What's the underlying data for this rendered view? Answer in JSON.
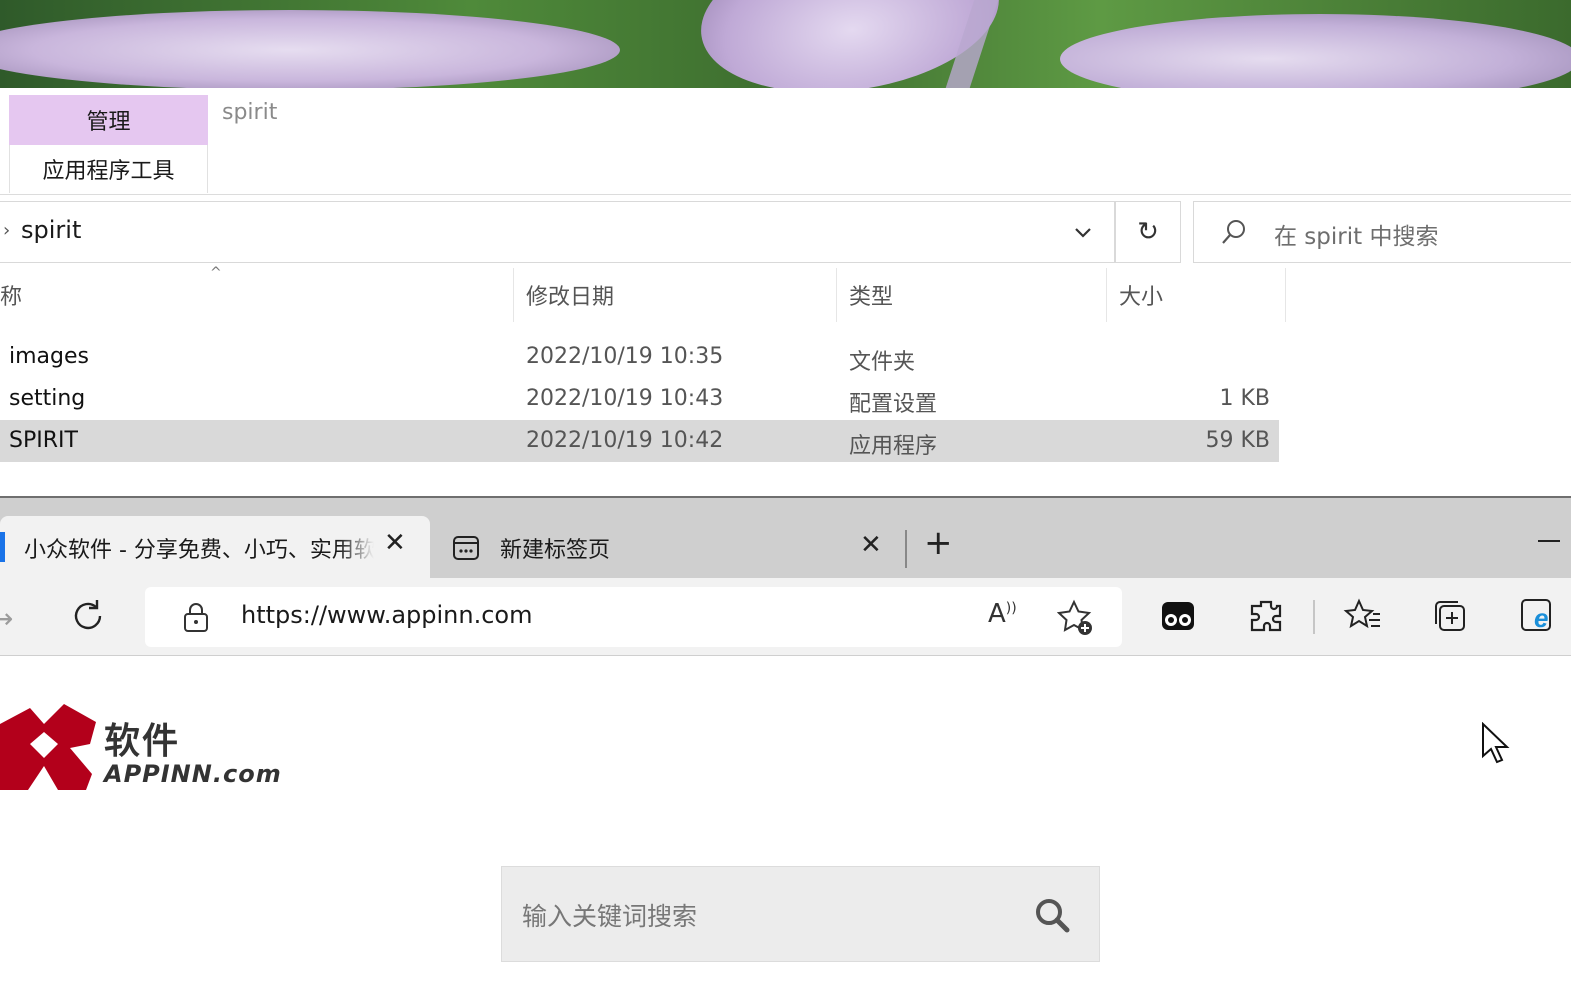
{
  "explorer": {
    "ribbon": {
      "manage_tab": "管理",
      "app_tools_tab": "应用程序工具",
      "context_title": "spirit"
    },
    "address": {
      "path": "spirit"
    },
    "search": {
      "placeholder": "在 spirit 中搜索"
    },
    "columns": [
      "称",
      "修改日期",
      "类型",
      "大小"
    ],
    "files": [
      {
        "name": "images",
        "date": "2022/10/19 10:35",
        "type": "文件夹",
        "size": ""
      },
      {
        "name": "setting",
        "date": "2022/10/19 10:43",
        "type": "配置设置",
        "size": "1 KB"
      },
      {
        "name": "SPIRIT",
        "date": "2022/10/19 10:42",
        "type": "应用程序",
        "size": "59 KB",
        "selected": true
      }
    ]
  },
  "browser": {
    "tabs": [
      {
        "title": "小众软件 - 分享免费、小巧、实用软件",
        "active": true
      },
      {
        "title": "新建标签页",
        "active": false
      }
    ],
    "url": "https://www.appinn.com",
    "accent_color": "#1a73e8"
  },
  "page": {
    "logo_cn": "软件",
    "logo_en": "APPINN.com",
    "search_placeholder": "输入关键词搜索",
    "logo_color": "#b3001b"
  }
}
